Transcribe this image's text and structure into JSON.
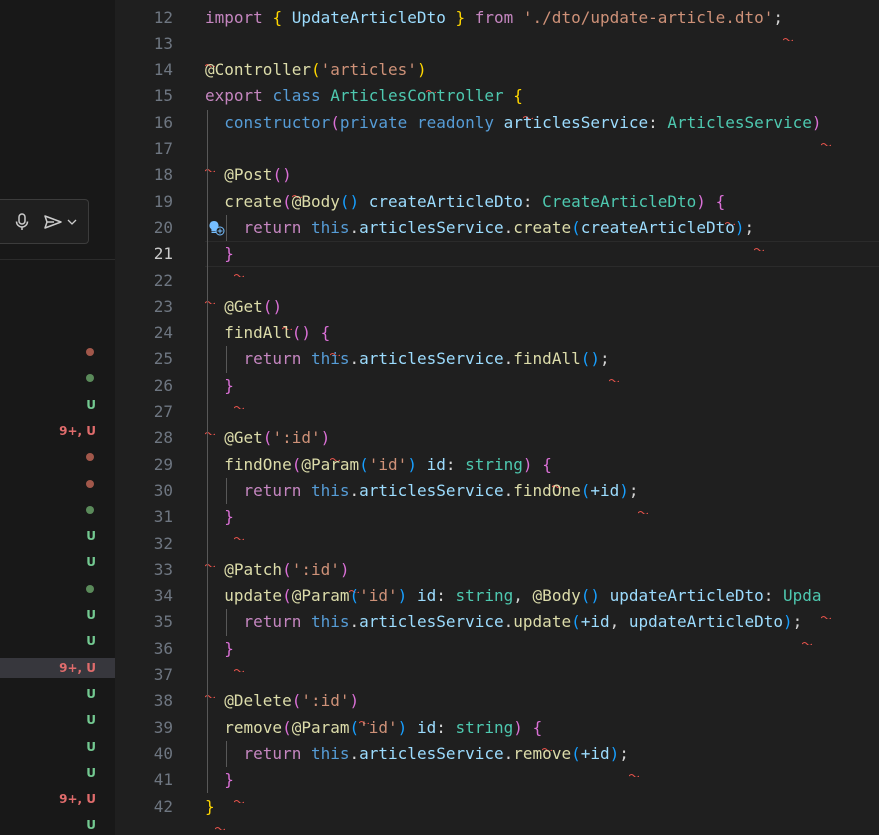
{
  "scm": {
    "rows": [
      {
        "type": "dot",
        "color": "#a1574a"
      },
      {
        "type": "dot",
        "color": "#5a8a5a"
      },
      {
        "type": "text",
        "label": "U",
        "color": "#73c991"
      },
      {
        "type": "text",
        "label": "9+, U",
        "color": "#e06c6c"
      },
      {
        "type": "dot",
        "color": "#a1574a"
      },
      {
        "type": "dot",
        "color": "#a1574a"
      },
      {
        "type": "dot",
        "color": "#5a8a5a"
      },
      {
        "type": "text",
        "label": "U",
        "color": "#73c991"
      },
      {
        "type": "text",
        "label": "U",
        "color": "#73c991"
      },
      {
        "type": "dot",
        "color": "#5a8a5a"
      },
      {
        "type": "text",
        "label": "U",
        "color": "#73c991"
      },
      {
        "type": "text",
        "label": "U",
        "color": "#73c991"
      },
      {
        "type": "text",
        "label": "9+, U",
        "color": "#e06c6c",
        "selected": true
      },
      {
        "type": "text",
        "label": "U",
        "color": "#73c991"
      },
      {
        "type": "text",
        "label": "U",
        "color": "#73c991"
      },
      {
        "type": "text",
        "label": "U",
        "color": "#73c991"
      },
      {
        "type": "text",
        "label": "U",
        "color": "#73c991"
      },
      {
        "type": "text",
        "label": "9+, U",
        "color": "#e06c6c"
      },
      {
        "type": "text",
        "label": "U",
        "color": "#73c991"
      }
    ]
  },
  "chat": {
    "mic_icon": "microphone-icon",
    "send_icon": "send-icon",
    "dropdown_icon": "chevron-down-icon"
  },
  "editor": {
    "active_line": 21,
    "lightbulb_line": 20,
    "lines": [
      {
        "n": "12",
        "tokens": [
          [
            "import ",
            "kw2"
          ],
          [
            "{ ",
            "br1"
          ],
          [
            "UpdateArticleDto",
            "var"
          ],
          [
            " } ",
            "br1"
          ],
          [
            "from ",
            "kw2"
          ],
          [
            "'./dto/update-article.dto'",
            "str"
          ],
          [
            ";",
            ""
          ]
        ]
      },
      {
        "n": "13",
        "tokens": []
      },
      {
        "n": "14",
        "tokens": [
          [
            "@",
            "fn"
          ],
          [
            "Controller",
            "fn"
          ],
          [
            "(",
            "br1"
          ],
          [
            "'articles'",
            "str"
          ],
          [
            ")",
            "br1"
          ]
        ]
      },
      {
        "n": "15",
        "tokens": [
          [
            "export ",
            "kw2"
          ],
          [
            "class ",
            "kw"
          ],
          [
            "ArticlesController ",
            "ty"
          ],
          [
            "{",
            "br1"
          ]
        ]
      },
      {
        "n": "16",
        "tokens": [
          [
            "  ",
            ""
          ],
          [
            "constructor",
            "kw"
          ],
          [
            "(",
            "br2"
          ],
          [
            "private ",
            "kw"
          ],
          [
            "readonly ",
            "kw"
          ],
          [
            "articlesService",
            "var"
          ],
          [
            ": ",
            ""
          ],
          [
            "ArticlesService",
            "ty"
          ],
          [
            ")",
            "br2"
          ]
        ]
      },
      {
        "n": "17",
        "tokens": []
      },
      {
        "n": "18",
        "tokens": [
          [
            "  ",
            ""
          ],
          [
            "@Post",
            "fn"
          ],
          [
            "(",
            "br2"
          ],
          [
            ")",
            "br2"
          ]
        ]
      },
      {
        "n": "19",
        "tokens": [
          [
            "  ",
            ""
          ],
          [
            "create",
            "fn"
          ],
          [
            "(",
            "br2"
          ],
          [
            "@Body",
            "fn"
          ],
          [
            "()",
            "br3"
          ],
          [
            " ",
            ""
          ],
          [
            "createArticleDto",
            "var"
          ],
          [
            ": ",
            ""
          ],
          [
            "CreateArticleDto",
            "ty"
          ],
          [
            ")",
            "br2"
          ],
          [
            " ",
            ""
          ],
          [
            "{",
            "br2"
          ]
        ]
      },
      {
        "n": "20",
        "tokens": [
          [
            "    ",
            ""
          ],
          [
            "return ",
            "kw2"
          ],
          [
            "this",
            "kw"
          ],
          [
            ".",
            ""
          ],
          [
            "articlesService",
            "var"
          ],
          [
            ".",
            ""
          ],
          [
            "create",
            "fn"
          ],
          [
            "(",
            "br3"
          ],
          [
            "createArticleDto",
            "var"
          ],
          [
            ")",
            "br3"
          ],
          [
            ";",
            ""
          ]
        ]
      },
      {
        "n": "21",
        "tokens": [
          [
            "  ",
            ""
          ],
          [
            "}",
            "br2"
          ]
        ]
      },
      {
        "n": "22",
        "tokens": []
      },
      {
        "n": "23",
        "tokens": [
          [
            "  ",
            ""
          ],
          [
            "@Get",
            "fn"
          ],
          [
            "(",
            "br2"
          ],
          [
            ")",
            "br2"
          ]
        ]
      },
      {
        "n": "24",
        "tokens": [
          [
            "  ",
            ""
          ],
          [
            "findAll",
            "fn"
          ],
          [
            "()",
            "br2"
          ],
          [
            " ",
            ""
          ],
          [
            "{",
            "br2"
          ]
        ]
      },
      {
        "n": "25",
        "tokens": [
          [
            "    ",
            ""
          ],
          [
            "return ",
            "kw2"
          ],
          [
            "this",
            "kw"
          ],
          [
            ".",
            ""
          ],
          [
            "articlesService",
            "var"
          ],
          [
            ".",
            ""
          ],
          [
            "findAll",
            "fn"
          ],
          [
            "()",
            "br3"
          ],
          [
            ";",
            ""
          ]
        ]
      },
      {
        "n": "26",
        "tokens": [
          [
            "  ",
            ""
          ],
          [
            "}",
            "br2"
          ]
        ]
      },
      {
        "n": "27",
        "tokens": []
      },
      {
        "n": "28",
        "tokens": [
          [
            "  ",
            ""
          ],
          [
            "@Get",
            "fn"
          ],
          [
            "(",
            "br2"
          ],
          [
            "':id'",
            "str"
          ],
          [
            ")",
            "br2"
          ]
        ]
      },
      {
        "n": "29",
        "tokens": [
          [
            "  ",
            ""
          ],
          [
            "findOne",
            "fn"
          ],
          [
            "(",
            "br2"
          ],
          [
            "@Param",
            "fn"
          ],
          [
            "(",
            "br3"
          ],
          [
            "'id'",
            "str"
          ],
          [
            ")",
            "br3"
          ],
          [
            " ",
            ""
          ],
          [
            "id",
            "var"
          ],
          [
            ": ",
            ""
          ],
          [
            "string",
            "ty"
          ],
          [
            ")",
            "br2"
          ],
          [
            " ",
            ""
          ],
          [
            "{",
            "br2"
          ]
        ]
      },
      {
        "n": "30",
        "tokens": [
          [
            "    ",
            ""
          ],
          [
            "return ",
            "kw2"
          ],
          [
            "this",
            "kw"
          ],
          [
            ".",
            ""
          ],
          [
            "articlesService",
            "var"
          ],
          [
            ".",
            ""
          ],
          [
            "findOne",
            "fn"
          ],
          [
            "(",
            "br3"
          ],
          [
            "+id",
            "var"
          ],
          [
            ")",
            "br3"
          ],
          [
            ";",
            ""
          ]
        ]
      },
      {
        "n": "31",
        "tokens": [
          [
            "  ",
            ""
          ],
          [
            "}",
            "br2"
          ]
        ]
      },
      {
        "n": "32",
        "tokens": []
      },
      {
        "n": "33",
        "tokens": [
          [
            "  ",
            ""
          ],
          [
            "@Patch",
            "fn"
          ],
          [
            "(",
            "br2"
          ],
          [
            "':id'",
            "str"
          ],
          [
            ")",
            "br2"
          ]
        ]
      },
      {
        "n": "34",
        "tokens": [
          [
            "  ",
            ""
          ],
          [
            "update",
            "fn"
          ],
          [
            "(",
            "br2"
          ],
          [
            "@Param",
            "fn"
          ],
          [
            "(",
            "br3"
          ],
          [
            "'id'",
            "str"
          ],
          [
            ")",
            "br3"
          ],
          [
            " ",
            ""
          ],
          [
            "id",
            "var"
          ],
          [
            ": ",
            ""
          ],
          [
            "string",
            "ty"
          ],
          [
            ", ",
            ""
          ],
          [
            "@Body",
            "fn"
          ],
          [
            "()",
            "br3"
          ],
          [
            " ",
            ""
          ],
          [
            "updateArticleDto",
            "var"
          ],
          [
            ": ",
            ""
          ],
          [
            "Upda",
            "ty"
          ]
        ]
      },
      {
        "n": "35",
        "tokens": [
          [
            "    ",
            ""
          ],
          [
            "return ",
            "kw2"
          ],
          [
            "this",
            "kw"
          ],
          [
            ".",
            ""
          ],
          [
            "articlesService",
            "var"
          ],
          [
            ".",
            ""
          ],
          [
            "update",
            "fn"
          ],
          [
            "(",
            "br3"
          ],
          [
            "+id",
            "var"
          ],
          [
            ", ",
            ""
          ],
          [
            "updateArticleDto",
            "var"
          ],
          [
            ")",
            "br3"
          ],
          [
            ";",
            ""
          ]
        ]
      },
      {
        "n": "36",
        "tokens": [
          [
            "  ",
            ""
          ],
          [
            "}",
            "br2"
          ]
        ]
      },
      {
        "n": "37",
        "tokens": []
      },
      {
        "n": "38",
        "tokens": [
          [
            "  ",
            ""
          ],
          [
            "@Delete",
            "fn"
          ],
          [
            "(",
            "br2"
          ],
          [
            "':id'",
            "str"
          ],
          [
            ")",
            "br2"
          ]
        ]
      },
      {
        "n": "39",
        "tokens": [
          [
            "  ",
            ""
          ],
          [
            "remove",
            "fn"
          ],
          [
            "(",
            "br2"
          ],
          [
            "@Param",
            "fn"
          ],
          [
            "(",
            "br3"
          ],
          [
            "'id'",
            "str"
          ],
          [
            ")",
            "br3"
          ],
          [
            " ",
            ""
          ],
          [
            "id",
            "var"
          ],
          [
            ": ",
            ""
          ],
          [
            "string",
            "ty"
          ],
          [
            ")",
            "br2"
          ],
          [
            " ",
            ""
          ],
          [
            "{",
            "br2"
          ]
        ]
      },
      {
        "n": "40",
        "tokens": [
          [
            "    ",
            ""
          ],
          [
            "return ",
            "kw2"
          ],
          [
            "this",
            "kw"
          ],
          [
            ".",
            ""
          ],
          [
            "articlesService",
            "var"
          ],
          [
            ".",
            ""
          ],
          [
            "remove",
            "fn"
          ],
          [
            "(",
            "br3"
          ],
          [
            "+id",
            "var"
          ],
          [
            ")",
            "br3"
          ],
          [
            ";",
            ""
          ]
        ]
      },
      {
        "n": "41",
        "tokens": [
          [
            "  ",
            ""
          ],
          [
            "}",
            "br2"
          ]
        ]
      },
      {
        "n": "42",
        "tokens": [
          [
            "}",
            "br1"
          ]
        ]
      }
    ]
  }
}
